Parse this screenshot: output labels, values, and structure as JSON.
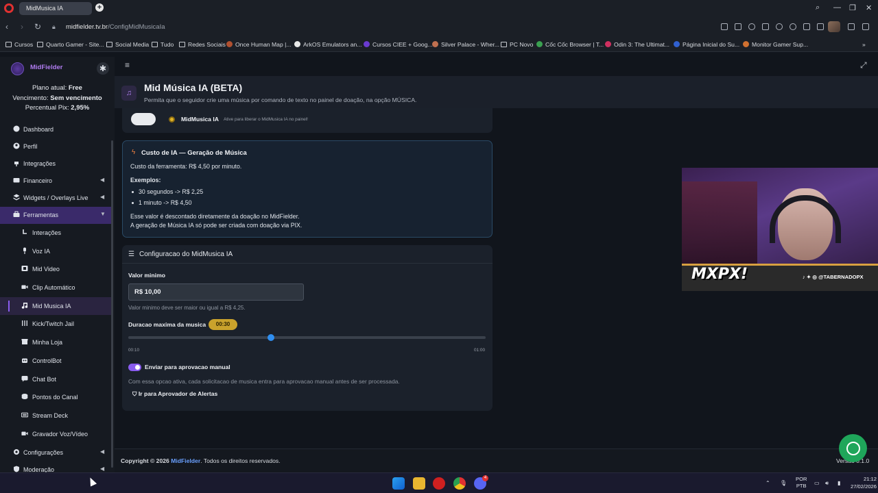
{
  "browser": {
    "tab_title": "MidMusica IA",
    "url_domain": "midfielder.tv.br",
    "url_path": "/ConfigMidMusicaIa"
  },
  "bookmarks": [
    "Cursos",
    "Quarto Gamer - Site...",
    "Social Media",
    "Tudo",
    "Redes Sociais",
    "Once Human Map |...",
    "ArkOS Emulators an...",
    "Cursos CIEE + Goog...",
    "Silver Palace - Wher...",
    "PC Novo",
    "Cốc Cốc Browser | T...",
    "Odin 3: The Ultimat...",
    "Página Inicial do Su...",
    "Monitor Gamer Sup..."
  ],
  "sidebar": {
    "brand": "MidFielder",
    "plan_label": "Plano atual:",
    "plan_value": "Free",
    "due_label": "Vencimento:",
    "due_value": "Sem vencimento",
    "pix_label": "Percentual Pix:",
    "pix_value": "2,95%",
    "items": [
      {
        "label": "Dashboard"
      },
      {
        "label": "Perfil"
      },
      {
        "label": "Integrações"
      },
      {
        "label": "Financeiro"
      },
      {
        "label": "Widgets / Overlays Live"
      },
      {
        "label": "Ferramentas"
      }
    ],
    "subitems": [
      {
        "label": "Interações"
      },
      {
        "label": "Voz IA"
      },
      {
        "label": "Mid Video"
      },
      {
        "label": "Clip Automático"
      },
      {
        "label": "Mid Musica IA"
      },
      {
        "label": "Kick/Twitch Jail"
      },
      {
        "label": "Minha Loja"
      },
      {
        "label": "ControlBot"
      },
      {
        "label": "Chat Bot"
      },
      {
        "label": "Pontos do Canal"
      },
      {
        "label": "Stream Deck"
      },
      {
        "label": "Gravador Voz/Vídeo"
      }
    ],
    "bottom_items": [
      {
        "label": "Configurações"
      },
      {
        "label": "Moderação"
      }
    ]
  },
  "header": {
    "title": "Mid Música IA (BETA)",
    "subtitle": "Permita que o seguidor crie uma música por comando de texto no painel de doação, na opção MÚSICA."
  },
  "toggle_row": {
    "label": "MidMusica IA",
    "hint": "Ative para liberar o MidMusica IA no painel!",
    "enabled": false
  },
  "cost": {
    "title": "Custo de IA — Geração de Música",
    "price_line": "Custo da ferramenta: R$ 4,50 por minuto.",
    "examples_label": "Exemplos:",
    "examples": [
      "30 segundos -> R$ 2,25",
      "1 minuto -> R$ 4,50"
    ],
    "note1": "Esse valor é descontado diretamente da doação no MidFielder.",
    "note2": "A geração de Música IA só pode ser criada com doação via PIX."
  },
  "config": {
    "title": "Configuracao do MidMusica IA",
    "min_label": "Valor minimo",
    "min_value": "R$ 10,00",
    "min_help": "Valor minimo deve ser maior ou igual a R$ 4,25.",
    "duration_label": "Duracao maxima da musica",
    "duration_badge": "00:30",
    "duration_fraction": 0.4,
    "range_min": "00:10",
    "range_max": "01:00",
    "manual_label": "Enviar para aprovacao manual",
    "manual_enabled": true,
    "manual_help": "Com essa opcao ativa, cada solicitacao de musica entra para aprovacao manual antes de ser processada.",
    "approver_button": "Ir para Aprovador de Alertas"
  },
  "footer": {
    "copyright_prefix": "Copyright © 2026 ",
    "brand": "MidFielder",
    "copyright_suffix": ". Todos os direitos reservados.",
    "version": "Versão 0.1.0"
  },
  "webcam": {
    "logo": "MXPX!",
    "handle": "@TABERNADOPX"
  },
  "taskbar": {
    "lang_top": "POR",
    "lang_bottom": "PTB",
    "time": "21:12",
    "date": "27/02/2026",
    "discord_badge": "4"
  }
}
